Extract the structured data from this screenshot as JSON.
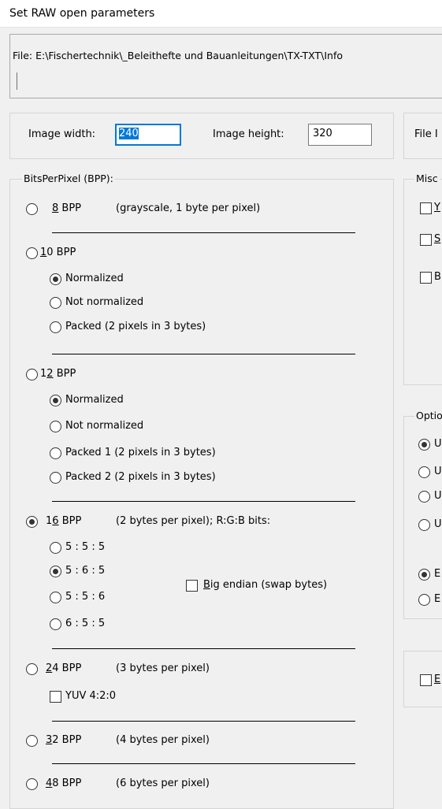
{
  "window": {
    "title": "Set RAW open parameters"
  },
  "file": {
    "line": "File: E:\\Fischertechnik\\_Beleithefte und Bauanleitungen\\TX-TXT\\Info"
  },
  "size": {
    "width_label": "Image width:",
    "width_value": "240",
    "height_label": "Image height:",
    "height_value": "320"
  },
  "right": {
    "file_label": "File I",
    "misc_label": "Misc",
    "misc_checks": [
      "Y",
      "S",
      "B"
    ],
    "options_label": "Optio",
    "option_radios": [
      "U",
      "U",
      "U",
      "U"
    ],
    "option_radios2": [
      "E",
      "E"
    ],
    "bottom_check": "E"
  },
  "bpp": {
    "group_label": "BitsPerPixel (BPP):",
    "bpp8": {
      "label_pre": "",
      "label_u": "8",
      "label_post": " BPP",
      "desc": "(grayscale, 1 byte per pixel)"
    },
    "bpp10": {
      "label_pre": "",
      "label_u": "1",
      "label_post": "0 BPP",
      "options": [
        "Normalized",
        "Not normalized",
        "Packed (2 pixels in 3 bytes)"
      ]
    },
    "bpp12": {
      "label_pre": "1",
      "label_u": "2",
      "label_post": " BPP",
      "options": [
        "Normalized",
        "Not normalized",
        "Packed 1 (2 pixels in 3 bytes)",
        "Packed 2 (2 pixels in 3 bytes)"
      ]
    },
    "bpp16": {
      "label_pre": "1",
      "label_u": "6",
      "label_post": " BPP",
      "desc": "(2 bytes per pixel); R:G:B bits:",
      "options": [
        "5 : 5 : 5",
        "5 : 6 : 5",
        "5 : 5 : 6",
        "6 : 5 : 5"
      ],
      "big_endian_u": "B",
      "big_endian_rest": "ig endian (swap bytes)"
    },
    "bpp24": {
      "label_pre": "",
      "label_u": "2",
      "label_post": "4 BPP",
      "desc": "(3 bytes per pixel)",
      "yuv": "YUV 4:2:0"
    },
    "bpp32": {
      "label_pre": "",
      "label_u": "3",
      "label_post": "2 BPP",
      "desc": "(4 bytes per pixel)"
    },
    "bpp48": {
      "label_pre": "",
      "label_u": "4",
      "label_post": "8 BPP",
      "desc": "(6 bytes per pixel)"
    }
  }
}
